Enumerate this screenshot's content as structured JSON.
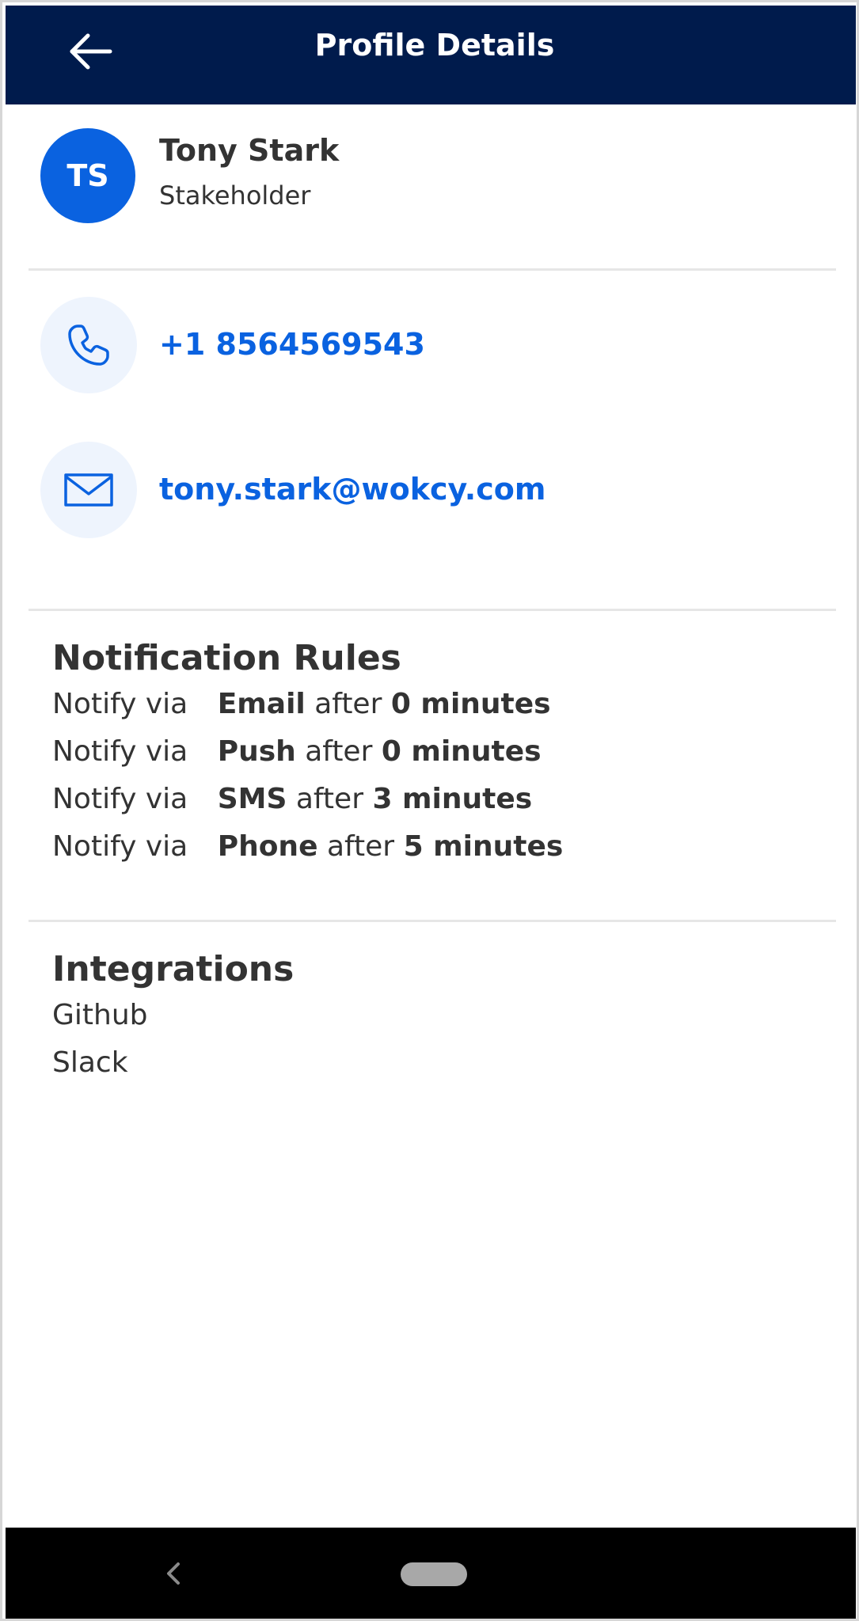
{
  "header": {
    "title": "Profile Details",
    "back_icon": "arrow-left-icon",
    "background_color": "#001b4c"
  },
  "profile": {
    "initials": "TS",
    "name": "Tony Stark",
    "role": "Stakeholder",
    "avatar_color": "#0a62e0"
  },
  "contacts": {
    "phone": {
      "icon": "phone-icon",
      "value": "+1 8564569543"
    },
    "email": {
      "icon": "mail-icon",
      "value": "tony.stark@wokcy.com"
    },
    "link_color": "#0a62e0"
  },
  "notification_rules": {
    "title": "Notification Rules",
    "rules": [
      {
        "prefix": "Notify via",
        "channel": "Email",
        "middle": "after",
        "delay": "0 minutes"
      },
      {
        "prefix": "Notify via",
        "channel": "Push",
        "middle": "after",
        "delay": "0 minutes"
      },
      {
        "prefix": "Notify via",
        "channel": "SMS",
        "middle": "after",
        "delay": "3 minutes"
      },
      {
        "prefix": "Notify via",
        "channel": "Phone",
        "middle": "after",
        "delay": "5 minutes"
      }
    ]
  },
  "integrations": {
    "title": "Integrations",
    "items": [
      "Github",
      "Slack"
    ]
  },
  "system_nav": {
    "back_icon": "chevron-left-icon",
    "home_icon": "home-pill-icon"
  }
}
